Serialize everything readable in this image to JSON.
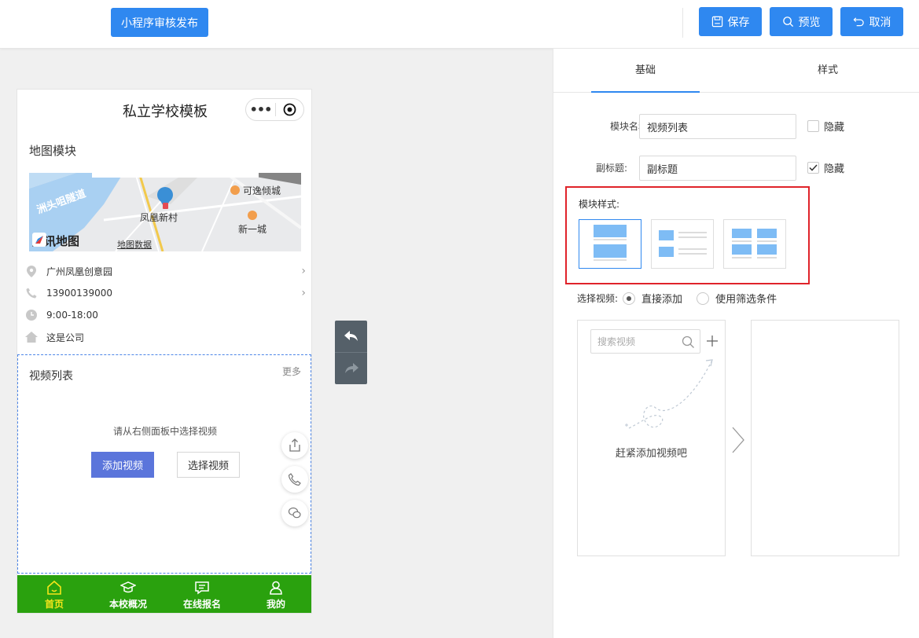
{
  "topbar": {
    "publish_label": "小程序审核发布",
    "save_label": "保存",
    "preview_label": "预览",
    "cancel_label": "取消"
  },
  "phone": {
    "title": "私立学校模板",
    "map_section_title": "地图模块",
    "map": {
      "labels": {
        "river_road": "洲头咀隧道",
        "village": "凤凰新村",
        "poi1": "可逸倾城",
        "poi2": "新一城",
        "brand": "腾讯地图",
        "data": "地图数据"
      }
    },
    "info": [
      {
        "icon": "location-icon",
        "text": "广州凤凰创意园",
        "has_arrow": true
      },
      {
        "icon": "phone-icon",
        "text": "13900139000",
        "has_arrow": true
      },
      {
        "icon": "clock-icon",
        "text": "9:00-18:00",
        "has_arrow": false
      },
      {
        "icon": "home-icon",
        "text": "这是公司",
        "has_arrow": false
      }
    ],
    "video_section": {
      "title": "视频列表",
      "more": "更多",
      "hint": "请从右侧面板中选择视频",
      "add_label": "添加视频",
      "select_label": "选择视频"
    },
    "tabbar": [
      {
        "icon": "home-icon",
        "label": "首页",
        "active": true
      },
      {
        "icon": "graduation-cap-icon",
        "label": "本校概况",
        "active": false
      },
      {
        "icon": "message-icon",
        "label": "在线报名",
        "active": false
      },
      {
        "icon": "user-icon",
        "label": "我的",
        "active": false
      }
    ]
  },
  "panel": {
    "tabs": [
      "基础",
      "样式"
    ],
    "active_tab": "基础",
    "module_name_label": "模块名称:",
    "module_name_value": "视频列表",
    "subtitle_label": "副标题:",
    "subtitle_value": "副标题",
    "hide_label": "隐藏",
    "hide_name_checked": false,
    "hide_subtitle_checked": true,
    "style_label": "模块样式:",
    "style_selected_index": 0,
    "select_video_label": "选择视频:",
    "radio_direct": "直接添加",
    "radio_filter": "使用筛选条件",
    "radio_selected": "直接添加",
    "search_placeholder": "搜索视频",
    "empty_text": "赶紧添加视频吧"
  },
  "colors": {
    "primary": "#2f88f0",
    "tabbar_green": "#2aa10e",
    "tab_active_yellow": "#f6e61a",
    "highlight_red": "#e0232a",
    "add_video_button": "#5b75db"
  }
}
